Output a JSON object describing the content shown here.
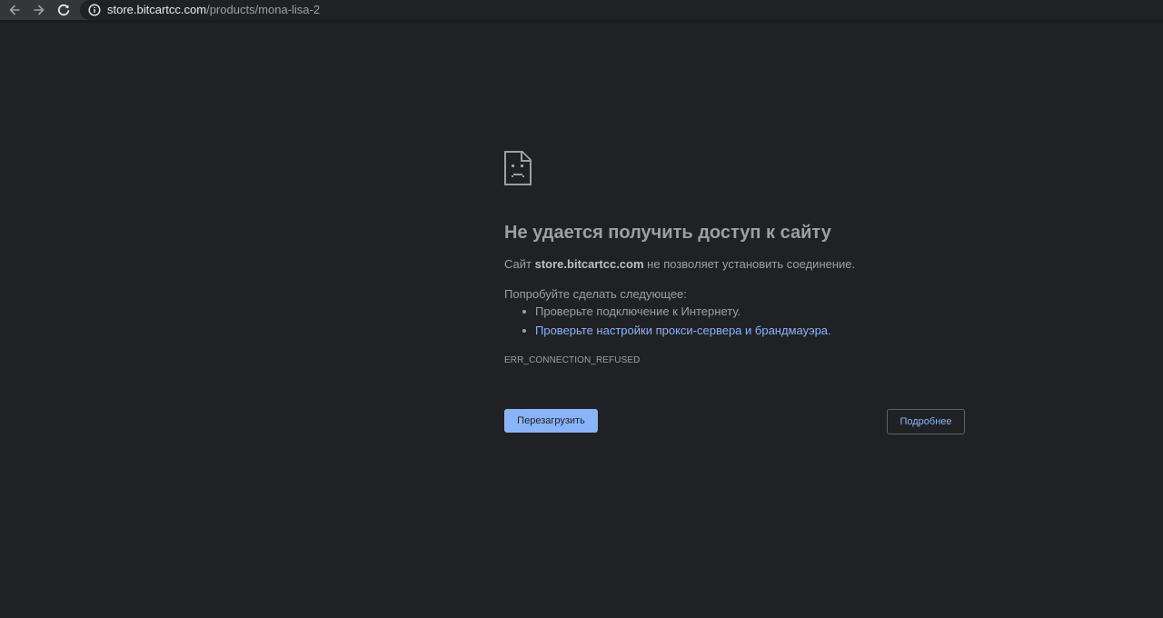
{
  "browser": {
    "url_host": "store.bitcartcc.com",
    "url_path": "/products/mona-lisa-2",
    "back_icon": "arrow-left-icon",
    "forward_icon": "arrow-right-icon",
    "reload_icon": "reload-icon",
    "info_icon": "info-icon"
  },
  "error_page": {
    "icon": "sad-page-icon",
    "heading": "Не удается получить доступ к сайту",
    "summary_prefix": "Сайт",
    "summary_host": "store.bitcartcc.com",
    "summary_suffix": "не позволяет установить соединение.",
    "try_label": "Попробуйте сделать следующее:",
    "suggestions": [
      {
        "text": "Проверьте подключение к Интернету.",
        "link": false
      },
      {
        "text": "Проверьте настройки прокси-сервера и брандмауэра",
        "link": true,
        "trail": "."
      }
    ],
    "error_code": "ERR_CONNECTION_REFUSED",
    "reload_button": "Перезагрузить",
    "details_button": "Подробнее"
  },
  "colors": {
    "background": "#202124",
    "text": "#9aa0a6",
    "link": "#8ab4f8",
    "primary_button": "#8ab4f8"
  }
}
